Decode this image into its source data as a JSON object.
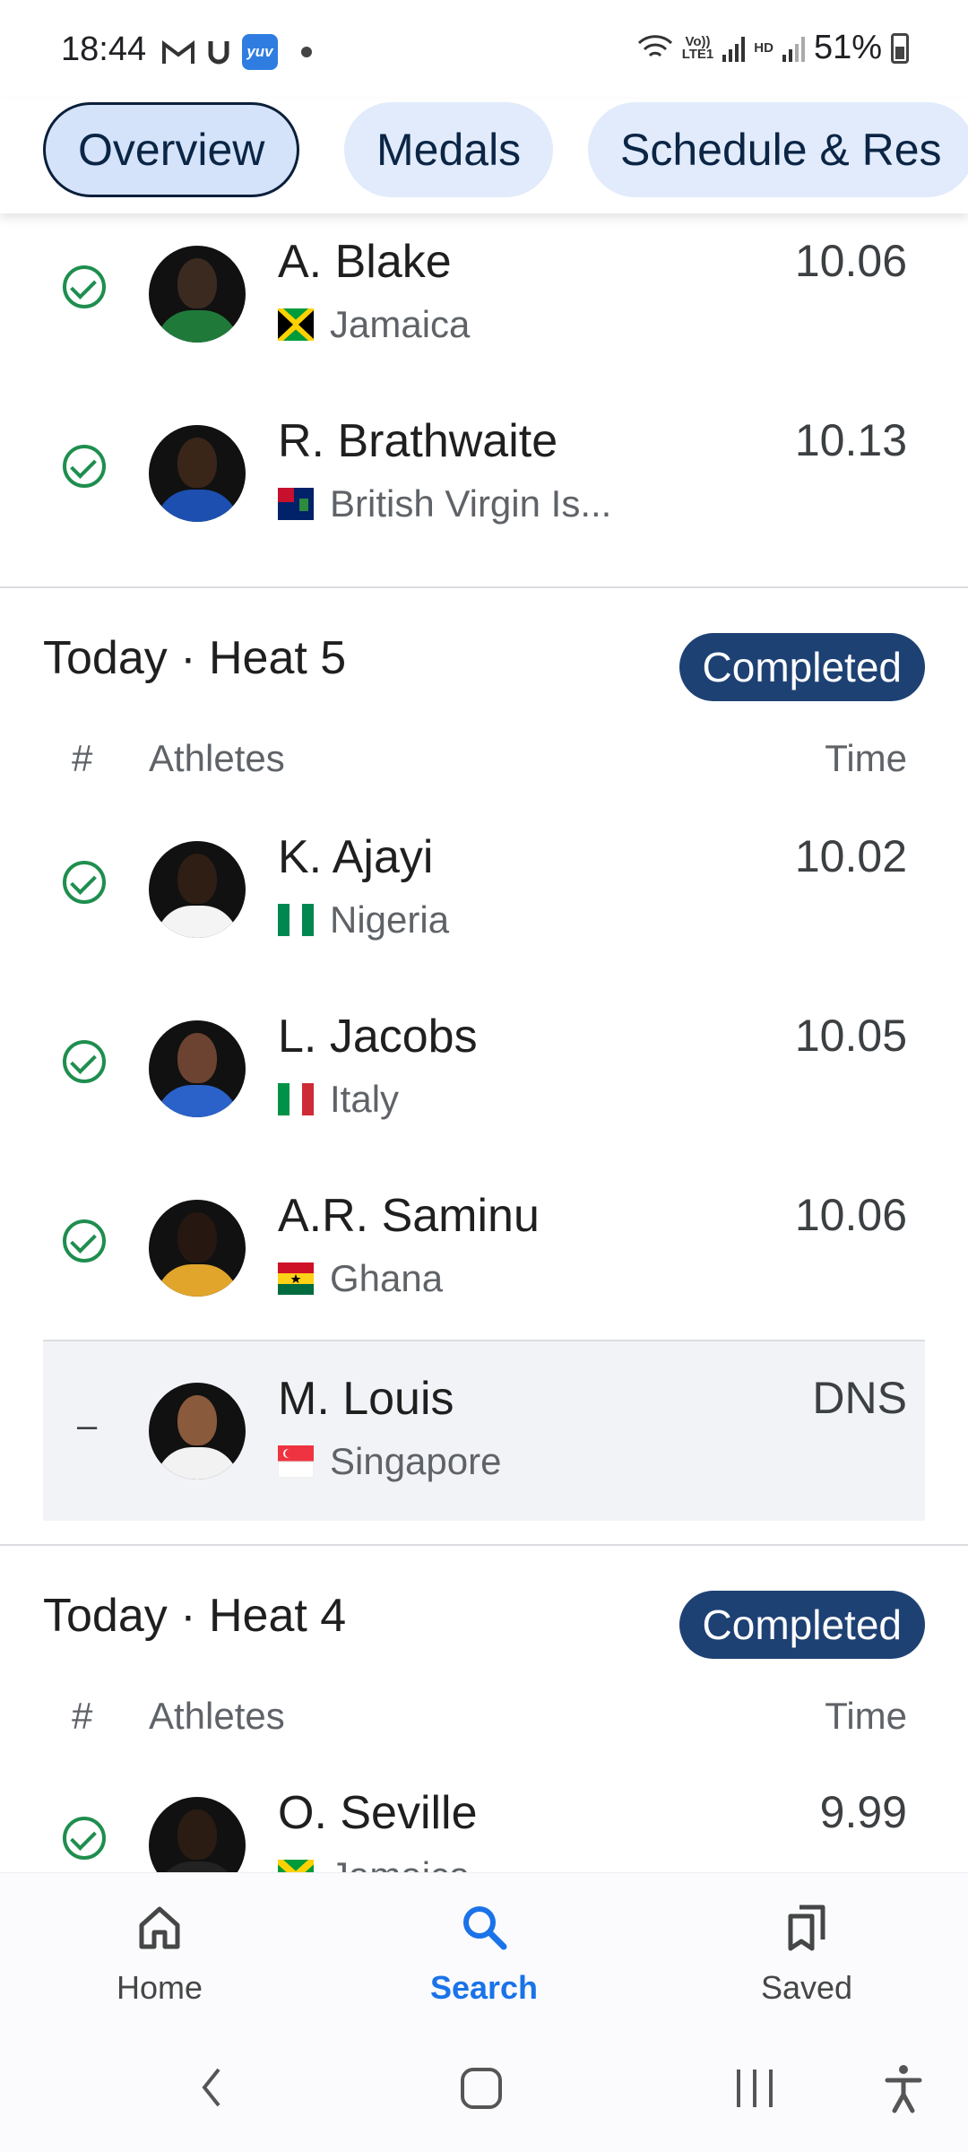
{
  "status_bar": {
    "time": "18:44",
    "network_top": "Vo))",
    "network_bottom": "LTE1",
    "hd": "HD",
    "battery": "51%"
  },
  "tabs": [
    {
      "label": "Overview",
      "active": true
    },
    {
      "label": "Medals",
      "active": false
    },
    {
      "label": "Schedule & Res",
      "active": false
    }
  ],
  "prev_heat": {
    "rows": [
      {
        "name": "A. Blake",
        "country": "Jamaica",
        "time": "10.06",
        "status": "qualified"
      },
      {
        "name": "R. Brathwaite",
        "country": "British Virgin Is...",
        "time": "10.13",
        "status": "qualified"
      }
    ]
  },
  "heat5": {
    "title": "Today · Heat 5",
    "badge": "Completed",
    "col_rank": "#",
    "col_athletes": "Athletes",
    "col_time": "Time",
    "rows": [
      {
        "name": "K. Ajayi",
        "country": "Nigeria",
        "time": "10.02",
        "status": "qualified"
      },
      {
        "name": "L. Jacobs",
        "country": "Italy",
        "time": "10.05",
        "status": "qualified"
      },
      {
        "name": "A.R. Saminu",
        "country": "Ghana",
        "time": "10.06",
        "status": "qualified"
      },
      {
        "name": "M. Louis",
        "country": "Singapore",
        "time": "DNS",
        "status": "dns",
        "rank_mark": "–"
      }
    ]
  },
  "heat4": {
    "title": "Today · Heat 4",
    "badge": "Completed",
    "col_rank": "#",
    "col_athletes": "Athletes",
    "col_time": "Time",
    "rows": [
      {
        "name": "O. Seville",
        "country": "Jamaica",
        "time": "9.99",
        "status": "qualified"
      }
    ]
  },
  "bottom_nav": [
    {
      "label": "Home",
      "icon": "home-icon",
      "active": false
    },
    {
      "label": "Search",
      "icon": "search-icon",
      "active": true
    },
    {
      "label": "Saved",
      "icon": "bookmarks-icon",
      "active": false
    }
  ],
  "colors": {
    "accent": "#1a73e8",
    "badge": "#1e4174",
    "check": "#1e8e4e",
    "tab_bg": "#e1ebfb"
  }
}
